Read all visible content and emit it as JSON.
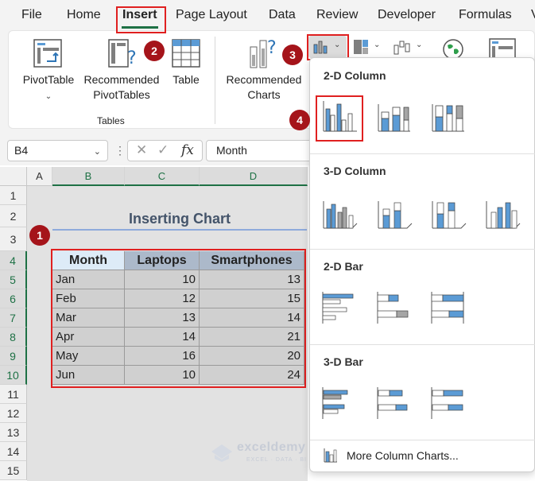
{
  "tabs": [
    "File",
    "Home",
    "Insert",
    "Page Layout",
    "Data",
    "Review",
    "Developer",
    "Formulas",
    "V"
  ],
  "ribbon": {
    "pivottable_label": "PivotTable",
    "recommended_pivot_line1": "Recommended",
    "recommended_pivot_line2": "PivotTables",
    "table_label": "Table",
    "tables_group": "Tables",
    "recommended_charts_line1": "Recommended",
    "recommended_charts_line2": "Charts"
  },
  "formula_bar": {
    "name_box": "B4",
    "fx": "fx",
    "value": "Month"
  },
  "columns": [
    "A",
    "B",
    "C",
    "D"
  ],
  "rows": [
    "1",
    "2",
    "3",
    "4",
    "5",
    "6",
    "7",
    "8",
    "9",
    "10",
    "11",
    "12",
    "13",
    "14",
    "15"
  ],
  "sheet": {
    "title": "Inserting Chart",
    "headers": [
      "Month",
      "Laptops",
      "Smartphones"
    ],
    "rows": [
      [
        "Jan",
        "10",
        "13"
      ],
      [
        "Feb",
        "12",
        "15"
      ],
      [
        "Mar",
        "13",
        "14"
      ],
      [
        "Apr",
        "14",
        "21"
      ],
      [
        "May",
        "16",
        "20"
      ],
      [
        "Jun",
        "10",
        "24"
      ]
    ]
  },
  "markers": [
    "1",
    "2",
    "3",
    "4"
  ],
  "gallery": {
    "sections": [
      "2-D Column",
      "3-D Column",
      "2-D Bar",
      "3-D Bar"
    ],
    "more_label": "More Column Charts...",
    "accent_color": "#5b9bd5",
    "secondary_color": "#a6a6a6"
  },
  "watermark": {
    "name": "exceldemy",
    "tagline": "EXCEL · DATA · BI"
  }
}
